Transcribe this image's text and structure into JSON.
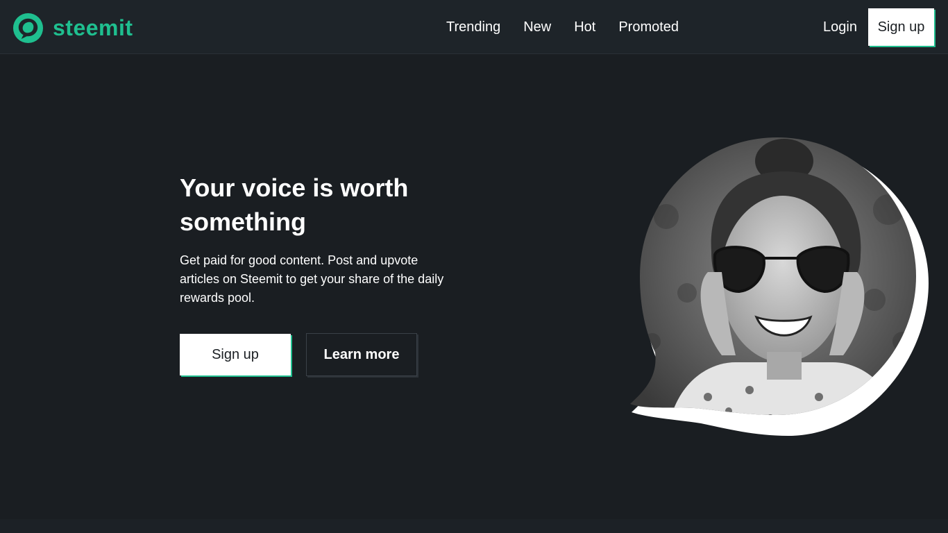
{
  "header": {
    "brand": "steemit",
    "nav": [
      "Trending",
      "New",
      "Hot",
      "Promoted"
    ],
    "login_label": "Login",
    "signup_label": "Sign up"
  },
  "hero": {
    "title": "Your voice is worth something",
    "subtitle": "Get paid for good content. Post and upvote articles on Steemit to get your share of the daily rewards pool.",
    "signup_label": "Sign up",
    "learn_more_label": "Learn more",
    "image": "woman-sunglasses-speech-bubble-photo"
  },
  "colors": {
    "brand_green": "#1fbf8f",
    "background": "#1a1e22",
    "header_bg": "#1e2429",
    "button_bg": "#ffffff"
  }
}
